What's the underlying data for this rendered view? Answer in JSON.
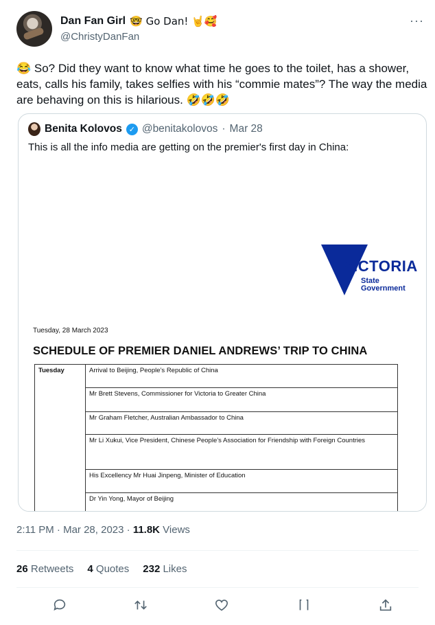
{
  "tweet": {
    "author_name": "Dan Fan Girl",
    "author_emojis": "🤓 Go Dan! 🤘🥰",
    "handle": "@ChristyDanFan",
    "more": "···",
    "text": "😂 So? Did they want to know what time he goes to the toilet, has a shower, eats, calls his family, takes selfies with his “commie mates”? The way the media are behaving on this is hilarious. 🤣🤣🤣"
  },
  "quote": {
    "name": "Benita Kolovos",
    "verified_mark": "✓",
    "handle": "@benitakolovos",
    "dot": "·",
    "date": "Mar 28",
    "text": "This is all the info media are getting on the premier's first day in China:",
    "document": {
      "logo_word": "VICTORIA",
      "logo_sub_1": "State",
      "logo_sub_2": "Government",
      "date": "Tuesday, 28 March 2023",
      "title": "SCHEDULE OF PREMIER DANIEL ANDREWS’ TRIP TO CHINA",
      "day": "Tuesday",
      "items": [
        "Arrival to Beijing, People’s Republic of China",
        "Mr Brett Stevens, Commissioner for Victoria to Greater China",
        "Mr Graham Fletcher, Australian Ambassador to China",
        "Mr Li Xukui, Vice President, Chinese People’s Association for Friendship with Foreign Countries",
        "His Excellency Mr Huai Jinpeng, Minister of Education",
        "Dr Yin Yong, Mayor of Beijing"
      ]
    }
  },
  "meta": {
    "time": "2:11 PM · Mar 28, 2023 · ",
    "views_count": "11.8K",
    "views_label": " Views"
  },
  "stats": {
    "retweets_count": "26",
    "retweets_label": " Retweets",
    "quotes_count": "4",
    "quotes_label": " Quotes",
    "likes_count": "232",
    "likes_label": " Likes"
  },
  "actions": [
    "reply-icon",
    "retweet-icon",
    "like-icon",
    "bookmark-icon",
    "share-icon"
  ],
  "colors": {
    "accent": "#1d9bf0",
    "victoria_blue": "#0a2a9a",
    "secondary_text": "#536471"
  }
}
